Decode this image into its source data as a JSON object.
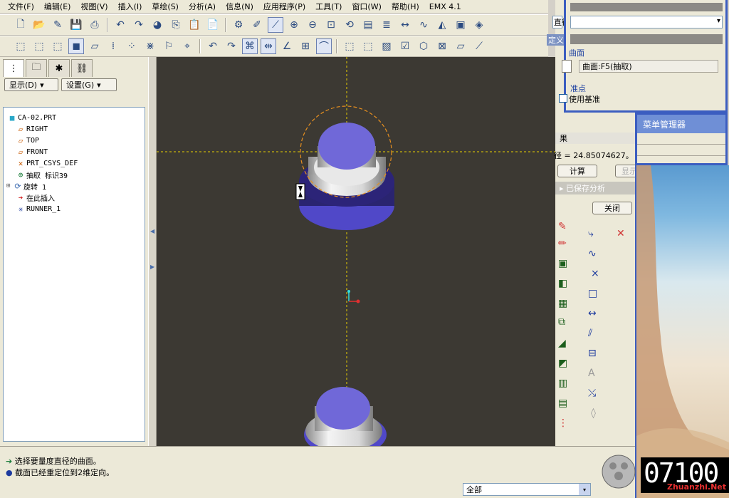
{
  "menu": [
    "文件(F)",
    "编辑(E)",
    "视图(V)",
    "插入(I)",
    "草绘(S)",
    "分析(A)",
    "信息(N)",
    "应用程序(P)",
    "工具(T)",
    "窗口(W)",
    "帮助(H)",
    "EMX 4.1"
  ],
  "left_panel": {
    "display_label": "显示(D)",
    "settings_label": "设置(G)",
    "tree": [
      {
        "icon": "part",
        "label": "CA-02.PRT"
      },
      {
        "icon": "datum-plane",
        "label": "RIGHT"
      },
      {
        "icon": "datum-plane",
        "label": "TOP"
      },
      {
        "icon": "datum-plane",
        "label": "FRONT"
      },
      {
        "icon": "csys",
        "label": "PRT_CSYS_DEF"
      },
      {
        "icon": "extract",
        "label": "抽取 标识39"
      },
      {
        "icon": "revolve",
        "label": "旋转 1"
      },
      {
        "icon": "insert-here",
        "label": "在此插入"
      },
      {
        "icon": "runner",
        "label": "RUNNER_1"
      }
    ]
  },
  "measure_dialog": {
    "type_value": "直径",
    "define_label": "定义",
    "surface_label": "曲面",
    "surface_value": "曲面:F5(抽取)",
    "datum_point_label": "准点",
    "use_datum_label": "使用基准",
    "result_label": "果",
    "diameter_text": "径 = 24.85074627。",
    "compute_button": "计算",
    "show_button": "显示",
    "saved_analysis_label": "已保存分析",
    "close_button": "关闭"
  },
  "menu_manager": {
    "title": "菜单管理器"
  },
  "status": {
    "message1": "选择要量度直径的曲面。",
    "message2": "截面已经重定位到2维定向。",
    "filter_value": "全部"
  },
  "watermark": {
    "number": "07100",
    "site": "Zhuanzhi.Net"
  },
  "colors": {
    "viewport": "#3c3933",
    "accent": "#3b5dc0",
    "model": "#7068d8"
  }
}
